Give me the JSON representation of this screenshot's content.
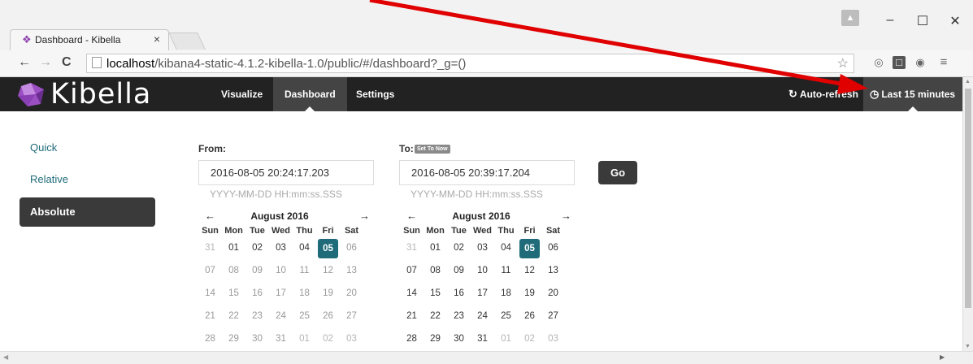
{
  "browser": {
    "tab_title": "Dashboard - Kibella",
    "tab_close": "×",
    "url_host": "localhost",
    "url_path": "/kibana4-static-4.1.2-kibella-1.0/public/#/dashboard?_g=()",
    "nav_back": "←",
    "nav_forward": "→",
    "nav_reload": "C",
    "window_minimize": "–",
    "window_maximize": "☐",
    "window_close": "✕",
    "menu": "≡"
  },
  "app": {
    "brand": "Kibella",
    "nav": {
      "visualize": "Visualize",
      "dashboard": "Dashboard",
      "settings": "Settings",
      "auto_refresh": "Auto-refresh",
      "time_filter": "Last 15 minutes"
    },
    "colors": {
      "navbar": "#222222",
      "active": "#444444",
      "accent": "#1f6b7a",
      "annotation": "#e00000"
    }
  },
  "timepicker": {
    "modes": [
      "Quick",
      "Relative",
      "Absolute"
    ],
    "active_mode": "Absolute",
    "from_label": "From:",
    "to_label": "To:",
    "set_to_now": "Set To Now",
    "from_value": "2016-08-05 20:24:17.203",
    "to_value": "2016-08-05 20:39:17.204",
    "format_hint": "YYYY-MM-DD HH:mm:ss.SSS",
    "go_label": "Go",
    "from_calendar": {
      "month": "August 2016",
      "prev": "←",
      "next": "→",
      "weekdays": [
        "Sun",
        "Mon",
        "Tue",
        "Wed",
        "Thu",
        "Fri",
        "Sat"
      ],
      "weeks": [
        [
          "31",
          "01",
          "02",
          "03",
          "04",
          "05",
          "06"
        ],
        [
          "07",
          "08",
          "09",
          "10",
          "11",
          "12",
          "13"
        ],
        [
          "14",
          "15",
          "16",
          "17",
          "18",
          "19",
          "20"
        ],
        [
          "21",
          "22",
          "23",
          "24",
          "25",
          "26",
          "27"
        ],
        [
          "28",
          "29",
          "30",
          "31",
          "01",
          "02",
          "03"
        ]
      ],
      "selected": "05"
    },
    "to_calendar": {
      "month": "August 2016",
      "prev": "←",
      "next": "→",
      "weekdays": [
        "Sun",
        "Mon",
        "Tue",
        "Wed",
        "Thu",
        "Fri",
        "Sat"
      ],
      "weeks": [
        [
          "31",
          "01",
          "02",
          "03",
          "04",
          "05",
          "06"
        ],
        [
          "07",
          "08",
          "09",
          "10",
          "11",
          "12",
          "13"
        ],
        [
          "14",
          "15",
          "16",
          "17",
          "18",
          "19",
          "20"
        ],
        [
          "21",
          "22",
          "23",
          "24",
          "25",
          "26",
          "27"
        ],
        [
          "28",
          "29",
          "30",
          "31",
          "01",
          "02",
          "03"
        ]
      ],
      "selected": "05"
    }
  }
}
